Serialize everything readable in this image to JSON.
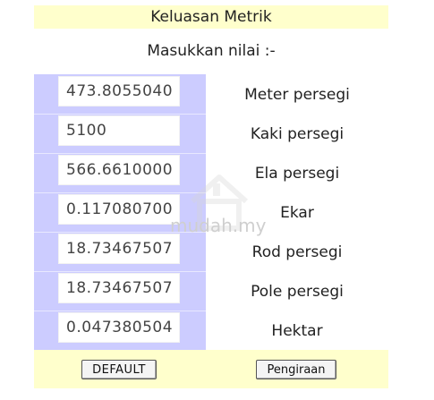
{
  "header": {
    "title": "Keluasan Metrik",
    "subtitle": "Masukkan nilai :-"
  },
  "rows": [
    {
      "value": "473.8055040",
      "unit": "Meter persegi"
    },
    {
      "value": "5100",
      "unit": "Kaki persegi"
    },
    {
      "value": "566.6610000",
      "unit": "Ela persegi"
    },
    {
      "value": "0.117080700",
      "unit": "Ekar"
    },
    {
      "value": "18.73467507",
      "unit": "Rod persegi"
    },
    {
      "value": "18.73467507",
      "unit": "Pole persegi"
    },
    {
      "value": "0.047380504",
      "unit": "Hektar"
    }
  ],
  "buttons": {
    "default_label": "DEFAULT",
    "calculate_label": "Pengiraan"
  },
  "watermark": {
    "text": "mudah.my",
    "icon": "house-icon"
  },
  "colors": {
    "header_bg": "#ffffcc",
    "input_column_bg": "#ccccff",
    "footer_bg": "#ffffcc"
  }
}
